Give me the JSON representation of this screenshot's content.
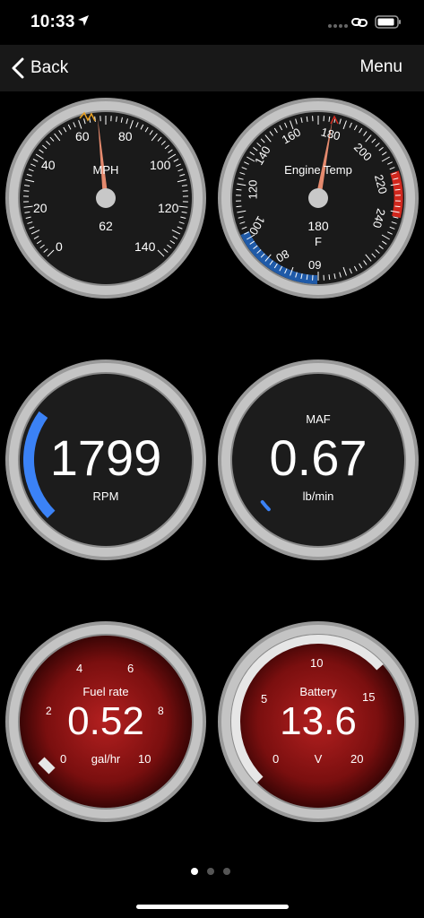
{
  "status": {
    "time": "10:33"
  },
  "nav": {
    "back_label": "Back",
    "menu_label": "Menu"
  },
  "speed_gauge": {
    "ticks": [
      "0",
      "20",
      "40",
      "60",
      "80",
      "100",
      "120",
      "140"
    ],
    "label": "MPH",
    "value": "62",
    "numeric_value": 62
  },
  "temp_gauge": {
    "ticks": [
      "60",
      "80",
      "100",
      "120",
      "140",
      "160",
      "180",
      "200",
      "220",
      "240"
    ],
    "label": "Engine Temp",
    "value": "180",
    "unit": "F",
    "numeric_value": 180
  },
  "rpm_gauge": {
    "value": "1799",
    "label": "RPM",
    "fill_fraction": 0.3
  },
  "maf_gauge": {
    "label": "MAF",
    "value": "0.67",
    "unit": "lb/min",
    "fill_fraction": 0.02
  },
  "fuel_gauge": {
    "label": "Fuel rate",
    "value": "0.52",
    "unit": "gal/hr",
    "ticks": [
      "0",
      "2",
      "4",
      "6",
      "8",
      "10"
    ],
    "numeric_value": 0.52
  },
  "battery_gauge": {
    "label": "Battery",
    "value": "13.6",
    "unit": "V",
    "ticks": [
      "0",
      "5",
      "10",
      "15",
      "20"
    ],
    "numeric_value": 13.6
  },
  "colors": {
    "rpm_arc": "#3b82f6",
    "temp_cold": "#1f5aa8",
    "temp_hot": "#d0271d",
    "needle": "#e58a6e",
    "red_face": "#8e1616"
  },
  "pager": {
    "pages": 3,
    "active": 0
  }
}
